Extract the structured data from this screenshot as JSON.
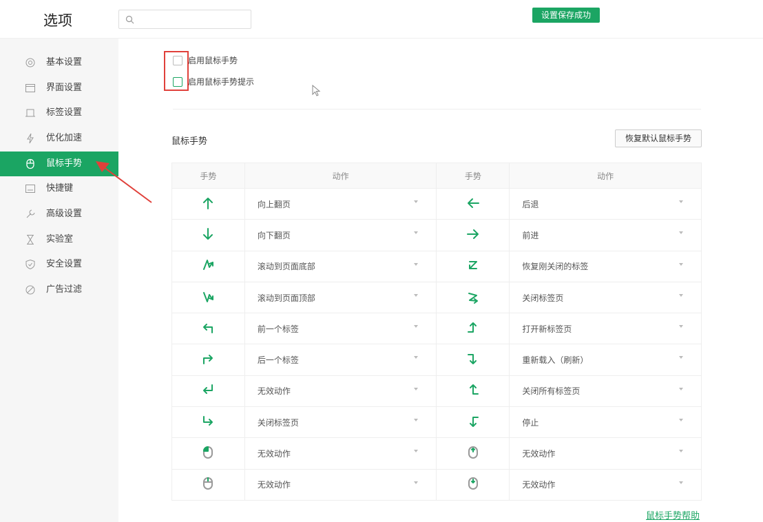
{
  "header": {
    "title": "选项",
    "toast": "设置保存成功"
  },
  "search": {
    "placeholder": ""
  },
  "sidebar": {
    "items": [
      {
        "label": "基本设置",
        "icon": "gear-icon"
      },
      {
        "label": "界面设置",
        "icon": "window-icon"
      },
      {
        "label": "标签设置",
        "icon": "tab-icon"
      },
      {
        "label": "优化加速",
        "icon": "lightning-icon"
      },
      {
        "label": "鼠标手势",
        "icon": "mouse-icon",
        "active": true
      },
      {
        "label": "快捷键",
        "icon": "keyboard-icon"
      },
      {
        "label": "高级设置",
        "icon": "wrench-icon"
      },
      {
        "label": "实验室",
        "icon": "flask-icon"
      },
      {
        "label": "安全设置",
        "icon": "shield-icon"
      },
      {
        "label": "广告过滤",
        "icon": "block-icon"
      }
    ]
  },
  "options": {
    "enable_gesture": {
      "label": "启用鼠标手势",
      "checked": false
    },
    "enable_gesture_hint": {
      "label": "启用鼠标手势提示",
      "checked": false
    }
  },
  "section": {
    "title": "鼠标手势",
    "reset_label": "恢复默认鼠标手势",
    "help_link": "鼠标手势帮助"
  },
  "table": {
    "headers": [
      "手势",
      "动作",
      "手势",
      "动作"
    ],
    "rows": [
      {
        "left_gesture": "arrow-up-icon",
        "left_action": "向上翻页",
        "right_gesture": "arrow-left-icon",
        "right_action": "后退"
      },
      {
        "left_gesture": "arrow-down-icon",
        "left_action": "向下翻页",
        "right_gesture": "arrow-right-icon",
        "right_action": "前进"
      },
      {
        "left_gesture": "zigzag-down-icon",
        "left_action": "滚动到页面底部",
        "right_gesture": "z-shape-icon",
        "right_action": "恢复刚关闭的标签"
      },
      {
        "left_gesture": "zigzag-up-icon",
        "left_action": "滚动到页面顶部",
        "right_gesture": "reverse-z-icon",
        "right_action": "关闭标签页"
      },
      {
        "left_gesture": "up-left-icon",
        "left_action": "前一个标签",
        "right_gesture": "right-up-icon",
        "right_action": "打开新标签页"
      },
      {
        "left_gesture": "up-right-icon",
        "left_action": "后一个标签",
        "right_gesture": "right-down-icon",
        "right_action": "重新载入（刷新）"
      },
      {
        "left_gesture": "down-left-icon",
        "left_action": "无效动作",
        "right_gesture": "left-up-icon",
        "right_action": "关闭所有标签页"
      },
      {
        "left_gesture": "down-right-icon",
        "left_action": "关闭标签页",
        "right_gesture": "left-down-icon",
        "right_action": "停止"
      },
      {
        "left_gesture": "mouse-left-click-icon",
        "left_action": "无效动作",
        "right_gesture": "mouse-scroll-up-icon",
        "right_action": "无效动作"
      },
      {
        "left_gesture": "mouse-right-click-icon",
        "left_action": "无效动作",
        "right_gesture": "mouse-scroll-down-icon",
        "right_action": "无效动作"
      }
    ]
  },
  "colors": {
    "accent": "#1ba563",
    "annotation": "#e0403a"
  }
}
